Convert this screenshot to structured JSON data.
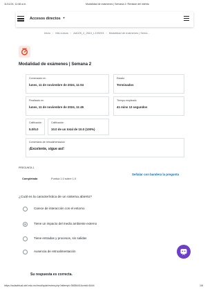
{
  "print_header": {
    "timestamp": "11/11/24, 11:48 a.m.",
    "title": "Modalidad de exámenes | Semana 2: Revisión del intento"
  },
  "topbar": {
    "quick_access": "Accesos directos"
  },
  "breadcrumb": [
    "Inicio",
    "Mis cursos",
    "AA025_2_2610_L109203",
    "Modalidad de exámenes | Sema..."
  ],
  "page_title": "Modalidad de exámenes | Semana 2",
  "summary": {
    "started": {
      "label": "Comenzado en",
      "value": "lunes, 11 de noviembre de 2024, 11:04"
    },
    "state": {
      "label": "Estado",
      "value": "Terminados"
    },
    "finished": {
      "label": "Finalizado en",
      "value": "lunes, 11 de noviembre de 2024, 11:45"
    },
    "time_taken": {
      "label": "Tiempo empleado",
      "value": "41 mins 13 segundos"
    },
    "marks": {
      "label": "Calificación",
      "value": "5.0/5.0"
    },
    "grade": {
      "label": "Calificación",
      "value": "10.0 de un total de 10.0 (100%)"
    },
    "feedback": {
      "label": "Comentario de retroalimentación",
      "value": "¡Excelente, sigue así!"
    }
  },
  "question": {
    "number": "PREGUNTA 1",
    "state": "Completada",
    "mark": "Puntúa 1.0 sobre 1.0",
    "flag": "Señalar con bandera la pregunta",
    "text": "¿Cuál es la característica de un sistema abierto?",
    "options": [
      {
        "label": "Carece de interacción con el entorno",
        "checked": false
      },
      {
        "label": "Tiene un impacto del medio ambiente externo",
        "checked": true
      },
      {
        "label": "Tiene entradas y procesos, sin salidas",
        "checked": false
      },
      {
        "label": "Ausencia de retroalimentación",
        "checked": false
      }
    ],
    "feedback": "Su respuesta es correcta."
  },
  "print_footer": {
    "url": "https://aulavirtual.utel.edu.mx/mod/quiz/review.php?attempt=3658441&cmid=6444",
    "page": "1/6"
  },
  "colors": {
    "link": "#0f6cbf",
    "quiz_icon": "#e2492b",
    "chat": "#6d3fc7"
  },
  "icons": {
    "menu": "hamburger-icon",
    "quiz": "quiz-icon",
    "chat": "chat-assistant-icon"
  }
}
